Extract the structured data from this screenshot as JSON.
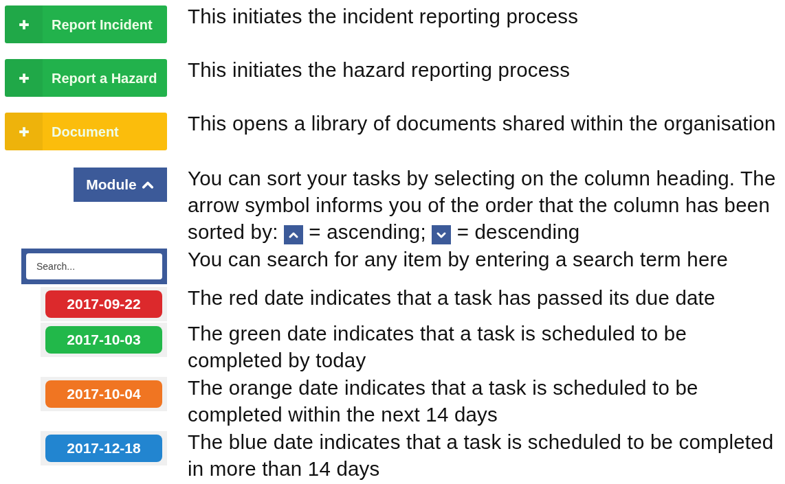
{
  "legend": [
    {
      "kind": "action_button",
      "label": "Report Incident",
      "color": "#22b24c",
      "description": [
        {
          "kind": "text",
          "text": "This initiates the incident reporting process"
        }
      ]
    },
    {
      "kind": "action_button",
      "label": "Report a Hazard",
      "color": "#22b24c",
      "description": [
        {
          "kind": "text",
          "text": "This initiates the hazard reporting process"
        }
      ]
    },
    {
      "kind": "action_button",
      "label": "Document",
      "color": "#fbbd0c",
      "description": [
        {
          "kind": "text",
          "text": "This opens a library of documents shared within the organisation"
        }
      ]
    },
    {
      "kind": "sort_header",
      "label": "Module",
      "ascending": true,
      "description": [
        {
          "kind": "text",
          "text": "You can sort your tasks by selecting on the column heading. The arrow symbol informs you of the order that the column has been sorted by: "
        },
        {
          "kind": "sort_icon",
          "ascending": true
        },
        {
          "kind": "text",
          "text": " = ascending; "
        },
        {
          "kind": "sort_icon",
          "ascending": false
        },
        {
          "kind": "text",
          "text": " = descending"
        }
      ]
    },
    {
      "kind": "search",
      "placeholder": "Search...",
      "description": [
        {
          "kind": "text",
          "text": "You can search for any item by entering a search term here"
        }
      ]
    },
    {
      "kind": "date",
      "label": "2017-09-22",
      "color": "#dc292c",
      "description": [
        {
          "kind": "text",
          "text": "The red date indicates that a task has passed its due date"
        }
      ]
    },
    {
      "kind": "date",
      "label": "2017-10-03",
      "color": "#22b84a",
      "description": [
        {
          "kind": "text",
          "text": "The green date indicates that a task is scheduled to be completed by today"
        }
      ]
    },
    {
      "kind": "date",
      "label": "2017-10-04",
      "color": "#f07522",
      "description": [
        {
          "kind": "text",
          "text": "The orange date indicates that a task is scheduled to be completed within the next 14 days"
        }
      ]
    },
    {
      "kind": "date",
      "label": "2017-12-18",
      "color": "#2285d0",
      "description": [
        {
          "kind": "text",
          "text": "The blue date indicates that a task is scheduled to be completed in more than 14 days"
        }
      ]
    }
  ]
}
